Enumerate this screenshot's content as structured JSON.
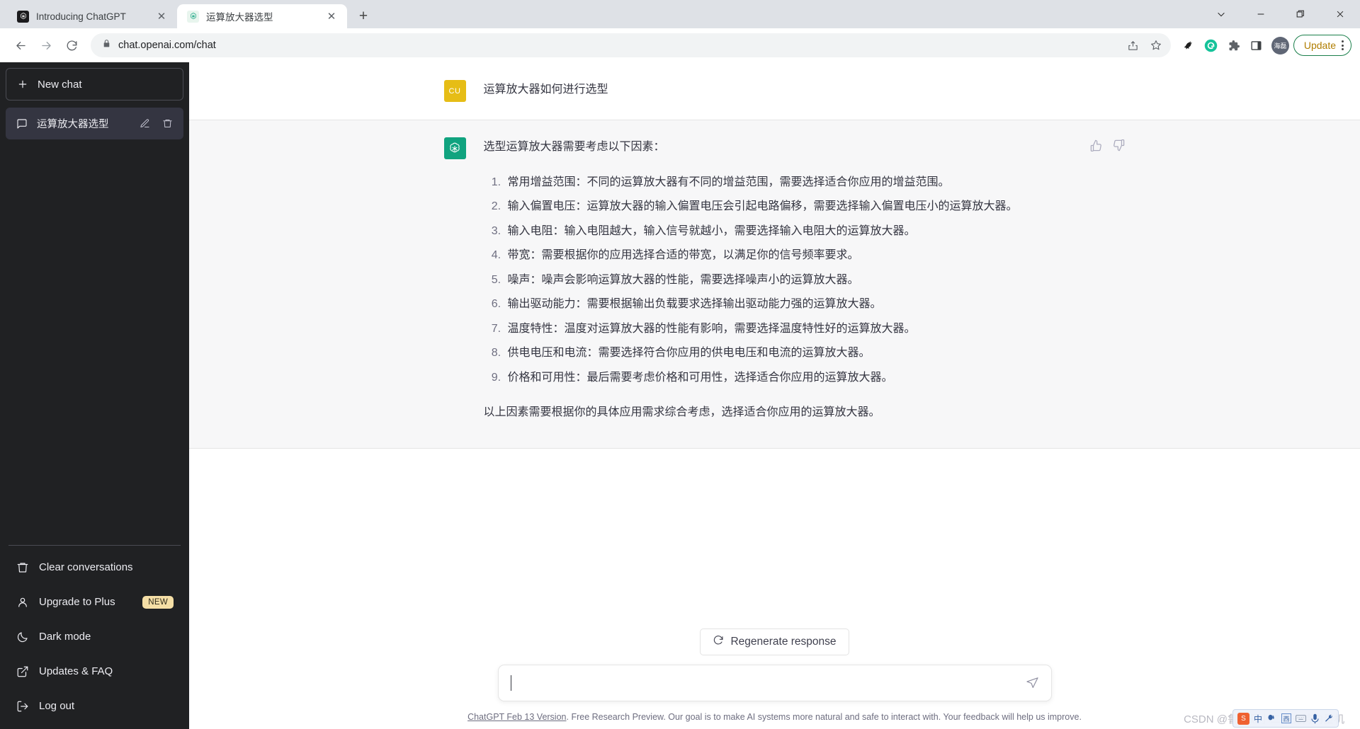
{
  "browser": {
    "tabs": [
      {
        "title": "Introducing ChatGPT",
        "favicon": "openai-logo-dark",
        "active": false,
        "close_label": "✕"
      },
      {
        "title": "运算放大器选型",
        "favicon": "openai-logo-light",
        "active": true,
        "close_label": "✕"
      }
    ],
    "new_tab_label": "+",
    "window_controls": {
      "minimize_group": "∨",
      "minimize": "—",
      "maximize": "❐",
      "close": "✕"
    },
    "nav": {
      "back": "←",
      "forward": "→",
      "reload": "⟳"
    },
    "omnibox": {
      "url": "chat.openai.com/chat",
      "lock_icon": "lock-icon",
      "share_icon": "share-icon",
      "bookmark_icon": "star-icon"
    },
    "extensions": [
      {
        "name": "bird-extension-icon",
        "glyph": "🐦"
      },
      {
        "name": "grammarly-icon",
        "glyph": "G",
        "color": "#15c39a"
      },
      {
        "name": "puzzle-extensions-icon",
        "glyph": "🧩"
      },
      {
        "name": "side-panel-icon",
        "glyph": "▣"
      }
    ],
    "profile": {
      "label": "海磊",
      "color": "#5f6675"
    },
    "update_button": {
      "label": "Update",
      "color": "#b07d00",
      "border": "#1a7f4b"
    }
  },
  "sidebar": {
    "new_chat": {
      "label": "New chat",
      "icon": "plus-icon"
    },
    "conversations": [
      {
        "title": "运算放大器选型",
        "icon": "chat-bubble-icon",
        "edit_icon": "pencil-icon",
        "delete_icon": "trash-icon",
        "active": true
      }
    ],
    "menu": [
      {
        "label": "Clear conversations",
        "icon": "trash-icon",
        "badge": ""
      },
      {
        "label": "Upgrade to Plus",
        "icon": "person-icon",
        "badge": "NEW"
      },
      {
        "label": "Dark mode",
        "icon": "moon-icon",
        "badge": ""
      },
      {
        "label": "Updates & FAQ",
        "icon": "external-link-icon",
        "badge": ""
      },
      {
        "label": "Log out",
        "icon": "logout-icon",
        "badge": ""
      }
    ],
    "badge_colors": {
      "new_bg": "#f5dfa6",
      "new_fg": "#2f2a1a"
    }
  },
  "chat": {
    "user_message": {
      "avatar_initials": "CU",
      "avatar_color": "#e6bd16",
      "text": "运算放大器如何进行选型"
    },
    "assistant_message": {
      "avatar_icon": "openai-logo-icon",
      "avatar_color": "#10a37f",
      "intro": "选型运算放大器需要考虑以下因素：",
      "items": [
        "常用增益范围：不同的运算放大器有不同的增益范围，需要选择适合你应用的增益范围。",
        "输入偏置电压：运算放大器的输入偏置电压会引起电路偏移，需要选择输入偏置电压小的运算放大器。",
        "输入电阻：输入电阻越大，输入信号就越小，需要选择输入电阻大的运算放大器。",
        "带宽：需要根据你的应用选择合适的带宽，以满足你的信号频率要求。",
        "噪声：噪声会影响运算放大器的性能，需要选择噪声小的运算放大器。",
        "输出驱动能力：需要根据输出负载要求选择输出驱动能力强的运算放大器。",
        "温度特性：温度对运算放大器的性能有影响，需要选择温度特性好的运算放大器。",
        "供电电压和电流：需要选择符合你应用的供电电压和电流的运算放大器。",
        "价格和可用性：最后需要考虑价格和可用性，选择适合你应用的运算放大器。"
      ],
      "closing": "以上因素需要根据你的具体应用需求综合考虑，选择适合你应用的运算放大器。",
      "thumbs_up_icon": "thumbs-up-icon",
      "thumbs_down_icon": "thumbs-down-icon"
    }
  },
  "composer": {
    "regenerate_label": "Regenerate response",
    "regenerate_icon": "refresh-icon",
    "input_value": "",
    "input_placeholder": "",
    "send_icon": "send-plane-icon"
  },
  "footer": {
    "link_text": "ChatGPT Feb 13 Version",
    "rest_text": ". Free Research Preview. Our goal is to make AI systems more natural and safe to interact with. Your feedback will help us improve."
  },
  "watermark": {
    "text": "CSDN @鲁棒最小二乘支持向量机",
    "ime": {
      "logo": "S",
      "items": [
        "中",
        "。，",
        "图",
        "⌨",
        "🎤",
        "🔧"
      ]
    }
  }
}
